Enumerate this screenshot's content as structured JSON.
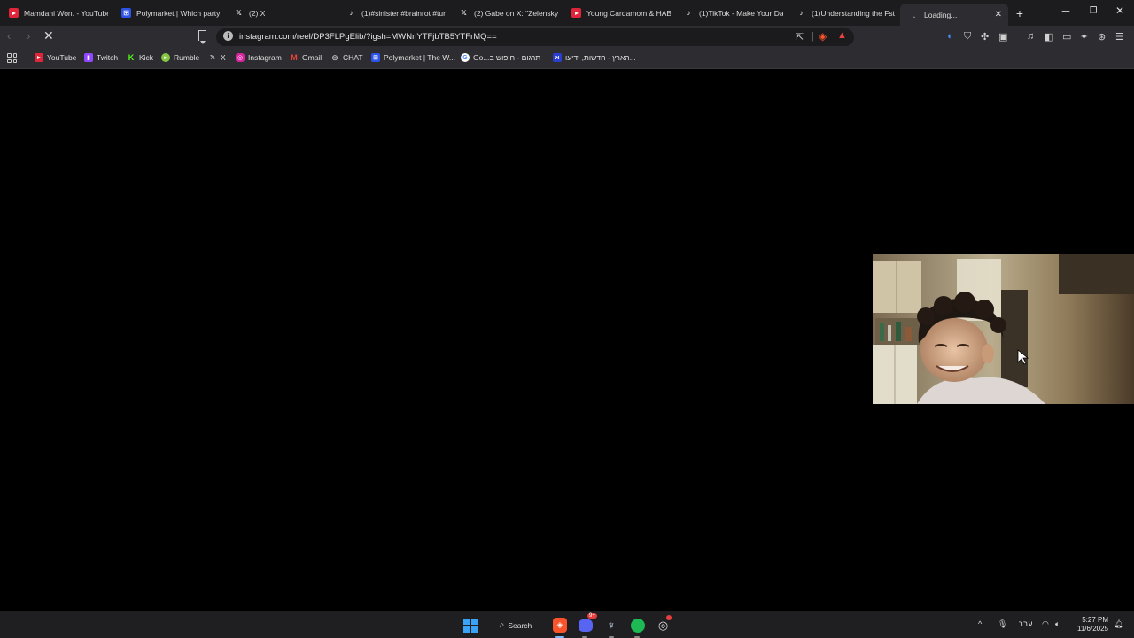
{
  "tabs": [
    {
      "label": "Mamdani Won. - YouTube",
      "icon": "youtube-icon",
      "active": false
    },
    {
      "label": "Polymarket | Which party",
      "icon": "polymarket-icon",
      "active": false
    },
    {
      "label": "(2) X",
      "icon": "x-icon",
      "active": false
    },
    {
      "label": "(1)#sinister #brainrot #tur",
      "icon": "tiktok-icon",
      "active": false
    },
    {
      "label": "(2) Gabe on X: \"Zelensky's",
      "icon": "x-icon",
      "active": false
    },
    {
      "label": "Young Cardamom & HAB",
      "icon": "youtube-icon",
      "active": false
    },
    {
      "label": "(1)TikTok - Make Your Day",
      "icon": "tiktok-icon",
      "active": false
    },
    {
      "label": "(1)Understanding the Fst",
      "icon": "tiktok-icon",
      "active": false
    },
    {
      "label": "Loading...",
      "icon": "loading-spinner-icon",
      "active": true
    }
  ],
  "toolbar": {
    "url": "instagram.com/reel/DP3FLPgElib/?igsh=MWNnYTFjbTB5YTFrMQ=="
  },
  "bookmarks": [
    {
      "label": "YouTube",
      "icon": "youtube-icon"
    },
    {
      "label": "Twitch",
      "icon": "twitch-icon"
    },
    {
      "label": "Kick",
      "icon": "kick-icon"
    },
    {
      "label": "Rumble",
      "icon": "rumble-icon"
    },
    {
      "label": "X",
      "icon": "x-icon"
    },
    {
      "label": "Instagram",
      "icon": "instagram-icon"
    },
    {
      "label": "Gmail",
      "icon": "gmail-icon"
    },
    {
      "label": "CHAT",
      "icon": "chatgpt-icon"
    },
    {
      "label": "Polymarket | The W...",
      "icon": "polymarket-icon"
    },
    {
      "label": "Go...תרגום - חיפוש ב",
      "icon": "google-icon"
    },
    {
      "label": "הארץ - חדשות, ידיעו...",
      "icon": "haaretz-icon"
    }
  ],
  "taskbar": {
    "search_label": "Search",
    "language": "עבר",
    "time": "5:27 PM",
    "date": "11/6/2025",
    "discord_badge": "9+"
  },
  "colors": {
    "tab_strip": "#1c1c1e",
    "toolbar": "#2d2d31",
    "page_background": "#000000",
    "taskbar": "#1f1f22",
    "brave_orange": "#fb542b",
    "windows_blue": "#3aa3f5"
  }
}
